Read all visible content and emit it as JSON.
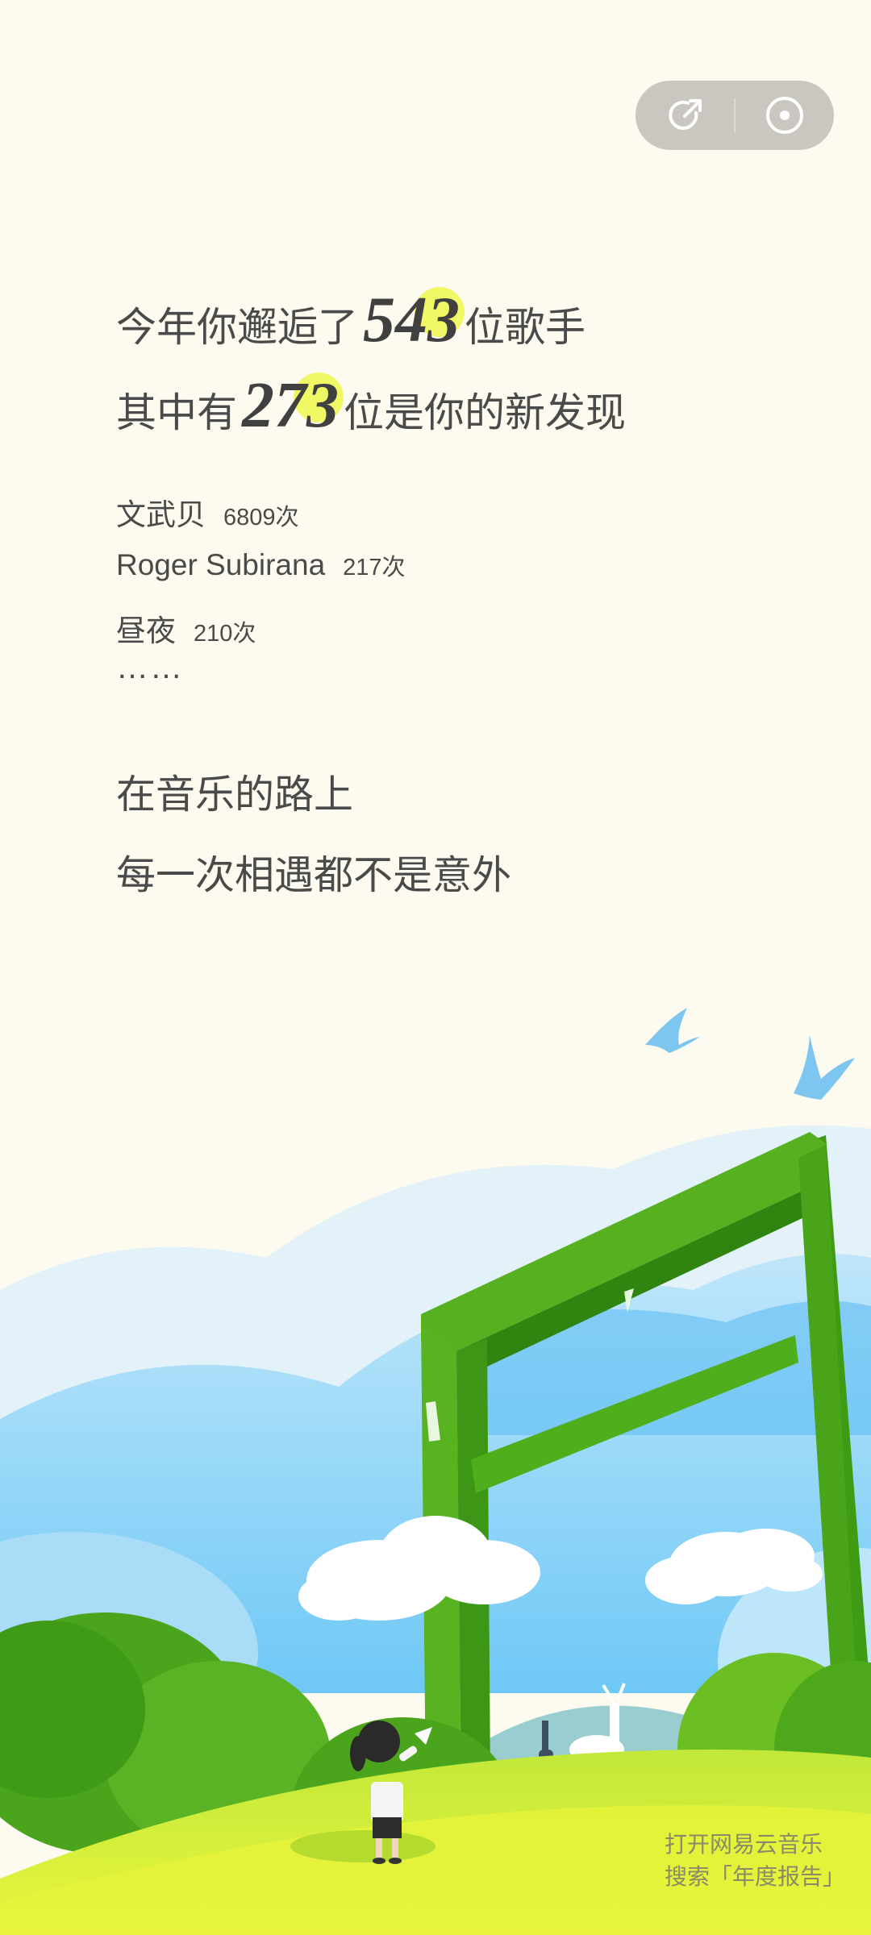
{
  "toolbar": {
    "share_icon": "share-icon",
    "record_icon": "record-icon"
  },
  "headline": {
    "line1_prefix": "今年你邂逅了",
    "line1_number": "543",
    "line1_suffix": "位歌手",
    "line2_prefix": "其中有",
    "line2_number": "273",
    "line2_suffix": "位是你的新发现"
  },
  "artists": [
    {
      "name": "文武贝",
      "count": "6809次"
    },
    {
      "name": "Roger Subirana",
      "count": "217次"
    },
    {
      "name": "昼夜",
      "count": "210次"
    }
  ],
  "ellipsis": "……",
  "poem": {
    "line1": "在音乐的路上",
    "line2": "每一次相遇都不是意外"
  },
  "footer": {
    "line1": "打开网易云音乐",
    "line2": "搜索「年度报告」"
  },
  "colors": {
    "background": "#fdfaf0",
    "highlight": "#eef74d",
    "gate_green": "#4aa61a",
    "sky_blue": "#6cc6f5",
    "grass": "#d9f03a"
  }
}
